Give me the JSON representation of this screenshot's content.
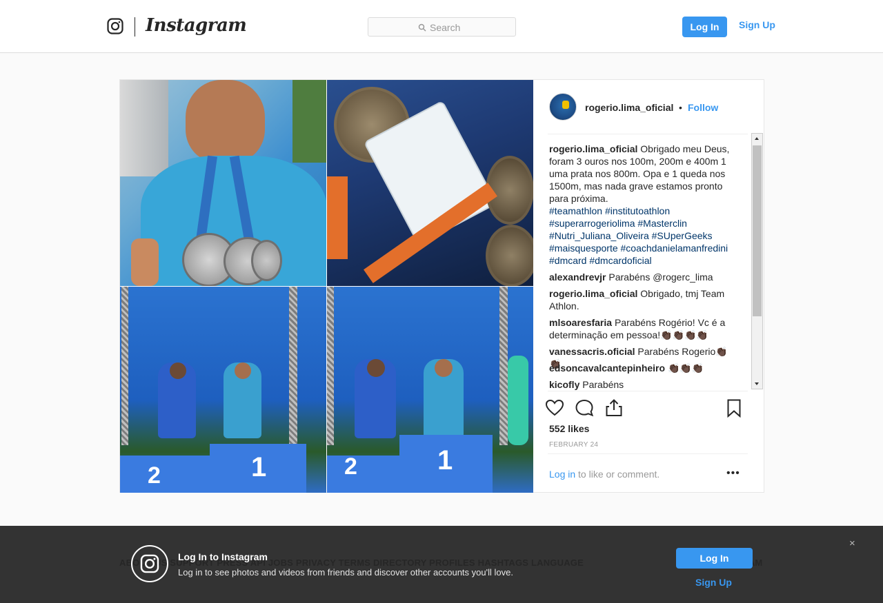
{
  "header": {
    "logo_text": "Instagram",
    "search_placeholder": "Search",
    "login_label": "Log In",
    "signup_label": "Sign Up"
  },
  "post": {
    "username": "rogerio.lima_oficial",
    "bullet": "•",
    "follow_label": "Follow",
    "caption": {
      "username": "rogerio.lima_oficial",
      "text": "Obrigado meu Deus, foram 3 ouros nos 100m, 200m e 400m 1 uma prata nos 800m. Opa e 1 queda nos 1500m, mas nada grave estamos pronto para próxima.",
      "hashtags": "#teamathlon #institutoathlon #superarrogeriolima #Masterclin #Nutri_Juliana_Oliveira #SUperGeeks #maisquesporte #coachdanielamanfredini #dmcard #dmcardoficial"
    },
    "comments": [
      {
        "username": "alexandrevjr",
        "text": "Parabéns @rogerc_lima"
      },
      {
        "username": "rogerio.lima_oficial",
        "text": "Obrigado, tmj Team Athlon."
      },
      {
        "username": "mlsoaresfaria",
        "text": "Parabéns Rogério! Vc é a determinação em pessoa!👏🏿👏🏿👏🏿👏🏿"
      },
      {
        "username": "vanessacris.oficial",
        "text": "Parabéns Rogerio👏🏿👏🏿"
      },
      {
        "username": "edsoncavalcantepinheiro",
        "text": "👏🏿👏🏿👏🏿"
      },
      {
        "username": "kicofly",
        "text": "Parabéns"
      }
    ],
    "likes": "552 likes",
    "date": "FEBRUARY 24",
    "login_link": "Log in",
    "login_suffix": " to like or comment.",
    "more": "•••"
  },
  "footer_under": {
    "links": "ABOUT US   SUPPORT   PRESS   API   JOBS   PRIVACY   TERMS   DIRECTORY   PROFILES   HASHTAGS   LANGUAGE",
    "right": "AM"
  },
  "banner": {
    "title": "Log In to Instagram",
    "text": "Log in to see photos and videos from friends and discover other accounts you'll love.",
    "login_label": "Log In",
    "signup_label": "Sign Up",
    "close": "×"
  }
}
